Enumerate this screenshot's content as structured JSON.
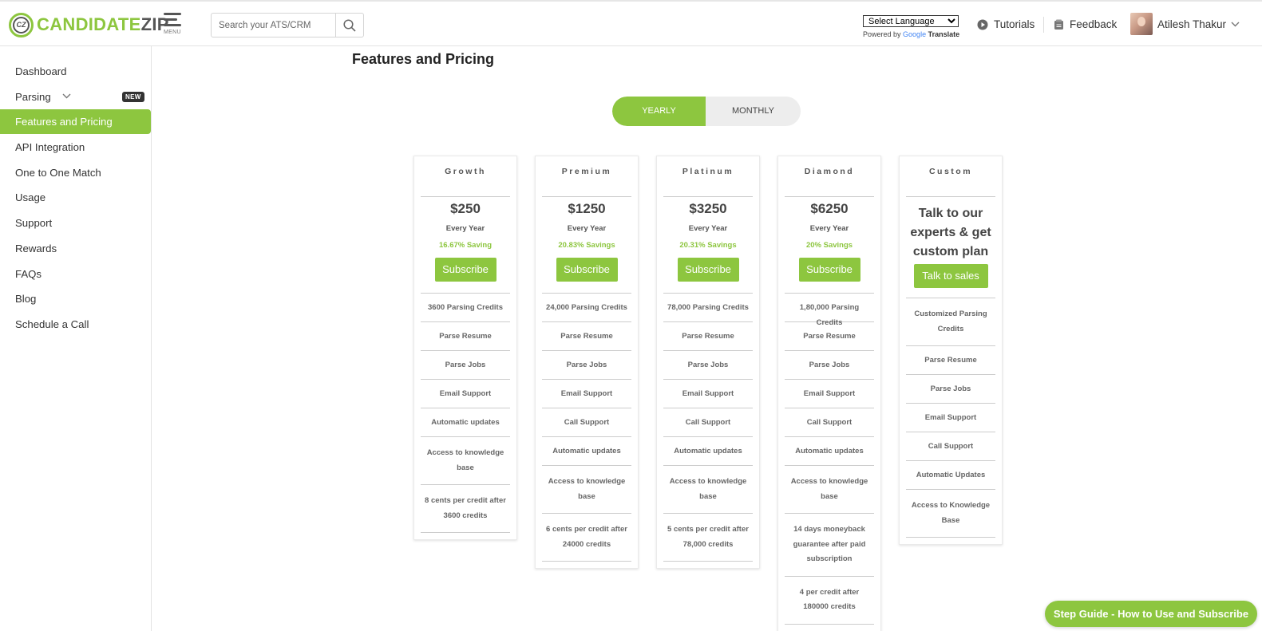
{
  "brand": {
    "part1": "CANDIDATE",
    "part2": "ZIP",
    "mark": "CZ",
    "color": "#8dc63f"
  },
  "header": {
    "menu_label": "MENU",
    "search_placeholder": "Search your ATS/CRM",
    "language_select": "Select Language",
    "powered_by": "Powered by",
    "google": "Google",
    "translate": "Translate",
    "tutorials": "Tutorials",
    "feedback": "Feedback",
    "user_name": "Atilesh Thakur"
  },
  "sidebar": {
    "items": [
      {
        "label": "Dashboard"
      },
      {
        "label": "Parsing",
        "badge": "NEW"
      },
      {
        "label": "Features and Pricing"
      },
      {
        "label": "API Integration"
      },
      {
        "label": "One to One Match"
      },
      {
        "label": "Usage"
      },
      {
        "label": "Support"
      },
      {
        "label": "Rewards"
      },
      {
        "label": "FAQs"
      },
      {
        "label": "Blog"
      },
      {
        "label": "Schedule a Call"
      }
    ]
  },
  "main": {
    "title": "Features and Pricing",
    "toggle": {
      "yearly": "YEARLY",
      "monthly": "MONTHLY"
    },
    "plans": [
      {
        "name": "Growth",
        "price": "$250",
        "period": "Every Year",
        "saving": "16.67% Saving",
        "button": "Subscribe",
        "features": [
          "3600 Parsing Credits",
          "Parse Resume",
          "Parse Jobs",
          "Email Support",
          "Automatic updates",
          "Access to knowledge base",
          "8 cents per credit after 3600 credits"
        ]
      },
      {
        "name": "Premium",
        "price": "$1250",
        "period": "Every Year",
        "saving": "20.83% Savings",
        "button": "Subscribe",
        "features": [
          "24,000 Parsing Credits",
          "Parse Resume",
          "Parse Jobs",
          "Email Support",
          "Call Support",
          "Automatic updates",
          "Access to knowledge base",
          "6 cents per credit after 24000 credits"
        ]
      },
      {
        "name": "Platinum",
        "price": "$3250",
        "period": "Every Year",
        "saving": "20.31% Savings",
        "button": "Subscribe",
        "features": [
          "78,000 Parsing Credits",
          "Parse Resume",
          "Parse Jobs",
          "Email Support",
          "Call Support",
          "Automatic updates",
          "Access to knowledge base",
          "5 cents per credit after 78,000 credits"
        ]
      },
      {
        "name": "Diamond",
        "price": "$6250",
        "period": "Every Year",
        "saving": "20% Savings",
        "button": "Subscribe",
        "features": [
          "1,80,000 Parsing Credits",
          "Parse Resume",
          "Parse Jobs",
          "Email Support",
          "Call Support",
          "Automatic updates",
          "Access to knowledge base",
          "14 days moneyback guarantee after paid subscription",
          "4 per credit after 180000 credits"
        ]
      },
      {
        "name": "Custom",
        "talk": "Talk to our experts & get custom plan",
        "button": "Talk to sales",
        "features": [
          "Customized Parsing Credits",
          "Parse Resume",
          "Parse Jobs",
          "Email Support",
          "Call Support",
          "Automatic Updates",
          "Access to Knowledge Base"
        ]
      }
    ]
  },
  "step_guide": "Step Guide - How to Use and Subscribe"
}
